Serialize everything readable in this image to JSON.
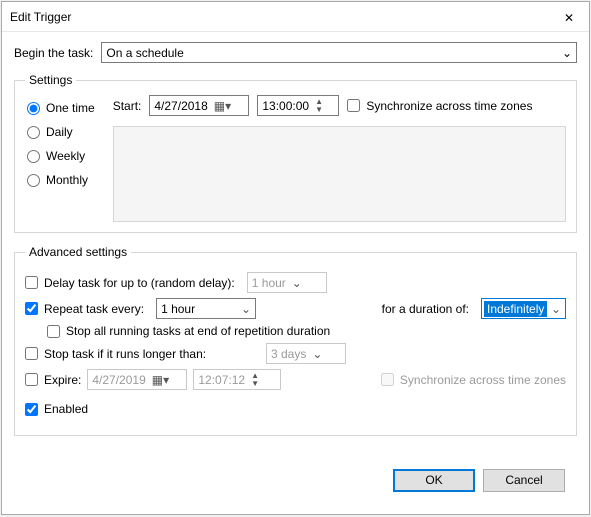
{
  "window": {
    "title": "Edit Trigger"
  },
  "begin": {
    "label": "Begin the task:",
    "value": "On a schedule"
  },
  "settings": {
    "legend": "Settings",
    "radios": {
      "one_time": "One time",
      "daily": "Daily",
      "weekly": "Weekly",
      "monthly": "Monthly",
      "selected": "one_time"
    },
    "start_label": "Start:",
    "start_date": "4/27/2018",
    "start_time": "13:00:00",
    "sync_label": "Synchronize across time zones"
  },
  "advanced": {
    "legend": "Advanced settings",
    "delay": {
      "label": "Delay task for up to (random delay):",
      "value": "1 hour",
      "checked": false
    },
    "repeat": {
      "label": "Repeat task every:",
      "value": "1 hour",
      "checked": true,
      "duration_label": "for a duration of:",
      "duration_value": "Indefinitely"
    },
    "stop_running": {
      "label": "Stop all running tasks at end of repetition duration",
      "checked": false
    },
    "stop_if": {
      "label": "Stop task if it runs longer than:",
      "value": "3 days",
      "checked": false
    },
    "expire": {
      "label": "Expire:",
      "date": "4/27/2019",
      "time": "12:07:12",
      "checked": false,
      "sync_label": "Synchronize across time zones"
    },
    "enabled": {
      "label": "Enabled",
      "checked": true
    }
  },
  "buttons": {
    "ok": "OK",
    "cancel": "Cancel"
  }
}
